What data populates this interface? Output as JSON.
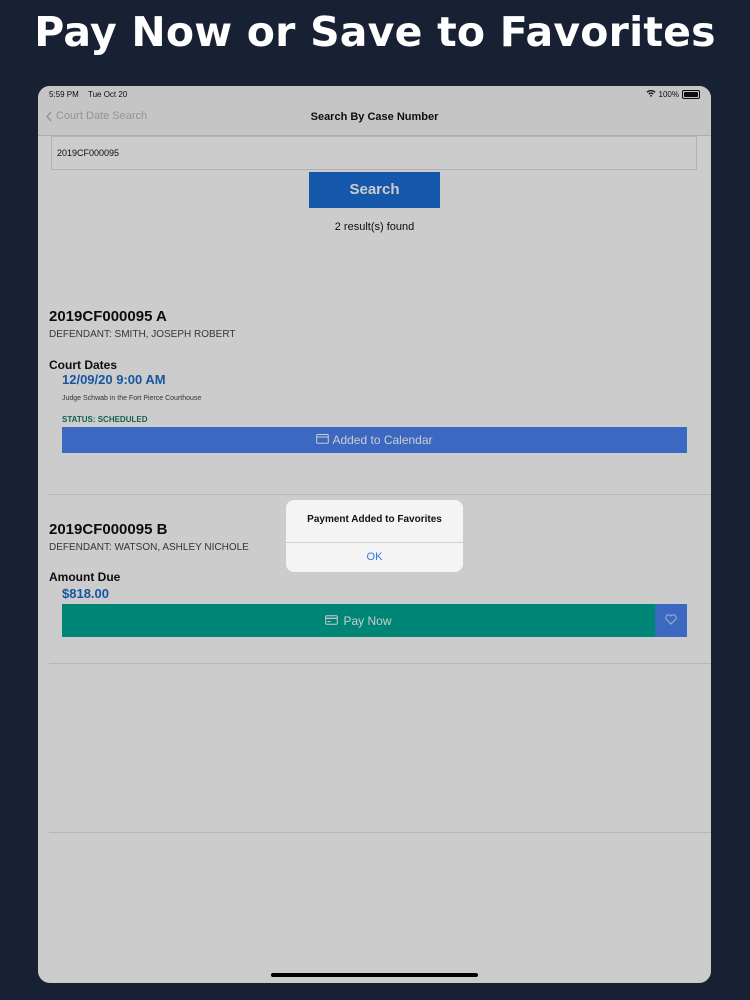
{
  "headline": "Pay Now or Save to Favorites",
  "status_bar": {
    "time": "5:59 PM",
    "date": "Tue Oct 20",
    "battery": "100%"
  },
  "nav": {
    "back_label": "Court Date Search",
    "title": "Search By Case Number"
  },
  "search": {
    "value": "2019CF000095",
    "button_label": "Search",
    "result_count": "2 result(s) found"
  },
  "results": [
    {
      "case_number": "2019CF000095 A",
      "defendant": "DEFENDANT: SMITH, JOSEPH ROBERT",
      "section_label": "Court Dates",
      "date_time": "12/09/20  9:00 AM",
      "location": "Judge Schwab in the Fort Pierce Courthouse",
      "status": "STATUS: SCHEDULED",
      "calendar_button": "Added to Calendar"
    },
    {
      "case_number": "2019CF000095 B",
      "defendant": "DEFENDANT: WATSON, ASHLEY NICHOLE",
      "section_label": "Amount Due",
      "amount": "$818.00",
      "pay_button": "Pay Now"
    }
  ],
  "alert": {
    "title": "Payment Added to Favorites",
    "ok_label": "OK"
  },
  "colors": {
    "background": "#182133",
    "primary_blue": "#1a6dd6",
    "pay_green": "#00a895",
    "accent_blue": "#4a84f2"
  },
  "icons": [
    "chevron-left-icon",
    "wifi-icon",
    "battery-icon",
    "calendar-icon",
    "credit-card-icon",
    "heart-icon"
  ]
}
